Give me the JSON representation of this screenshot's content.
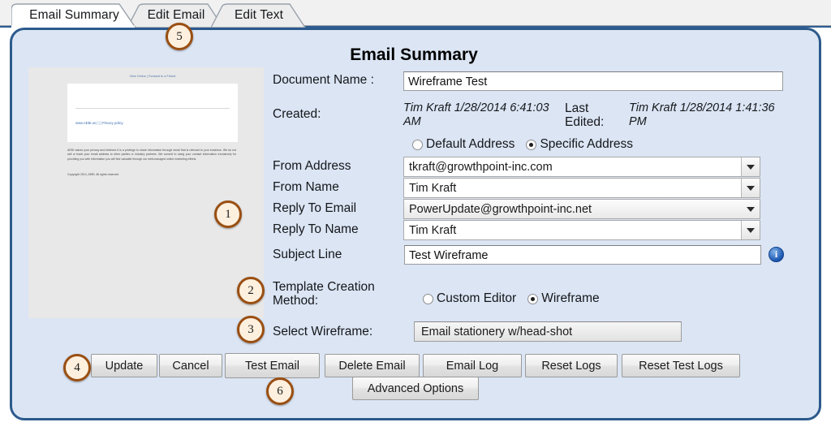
{
  "tabs": [
    {
      "label": "Email Summary",
      "active": true
    },
    {
      "label": "Edit Email",
      "active": false
    },
    {
      "label": "Edit Text",
      "active": false
    }
  ],
  "panel": {
    "title": "Email Summary"
  },
  "preview": {
    "top_link": "View Online | Forward to a Friend",
    "body_link": "www.AEBI.us | | | Privacy policy",
    "paragraph": "AEBI values your privacy and believes it is a privilege to share information through email that is relevant to your business. We do not sell or trade your email address to other parties or industry partners. We commit to using your contact information exclusively for providing you with information you will find valuable through our well-managed online marketing efforts.",
    "copyright": "Copyright 2014, AEBI. All rights reserved"
  },
  "form": {
    "document_name_label": "Document Name :",
    "document_name_value": "Wireframe Test",
    "created_label": "Created:",
    "created_value": "Tim Kraft 1/28/2014 6:41:03 AM",
    "last_edited_label": "Last Edited:",
    "last_edited_value": "Tim Kraft 1/28/2014 1:41:36 PM",
    "address_mode": [
      {
        "label": "Default Address",
        "selected": false
      },
      {
        "label": "Specific Address",
        "selected": true
      }
    ],
    "from_address_label": "From Address",
    "from_address_value": "tkraft@growthpoint-inc.com",
    "from_name_label": "From Name",
    "from_name_value": "Tim Kraft",
    "reply_to_email_label": "Reply To Email",
    "reply_to_email_value": "PowerUpdate@growthpoint-inc.net",
    "reply_to_name_label": "Reply To Name",
    "reply_to_name_value": "Tim Kraft",
    "subject_line_label": "Subject Line",
    "subject_line_value": "Test Wireframe",
    "info_icon_glyph": "i",
    "template_method_label_1": "Template Creation",
    "template_method_label_2": "Method:",
    "template_method_options": [
      {
        "label": "Custom Editor",
        "selected": false
      },
      {
        "label": "Wireframe",
        "selected": true
      }
    ],
    "select_wireframe_label": "Select Wireframe:",
    "select_wireframe_value": "Email stationery w/head-shot"
  },
  "buttons": {
    "update": "Update",
    "cancel": "Cancel",
    "test_email": "Test Email",
    "delete_email": "Delete Email",
    "email_log": "Email Log",
    "reset_logs": "Reset Logs",
    "reset_test_logs": "Reset Test Logs",
    "advanced_options": "Advanced Options"
  },
  "callouts": [
    {
      "n": "1"
    },
    {
      "n": "2"
    },
    {
      "n": "3"
    },
    {
      "n": "4"
    },
    {
      "n": "5"
    },
    {
      "n": "6"
    }
  ],
  "colors": {
    "panel_border": "#2c5a8c",
    "panel_fill": "#dbe5f4",
    "tab_bar": "#f1f1f1",
    "badge_ring": "#9a4f12",
    "badge_fill": "#fdf0de",
    "info_blue": "#1a56b0",
    "thumb_bg": "#e8e8e8"
  }
}
